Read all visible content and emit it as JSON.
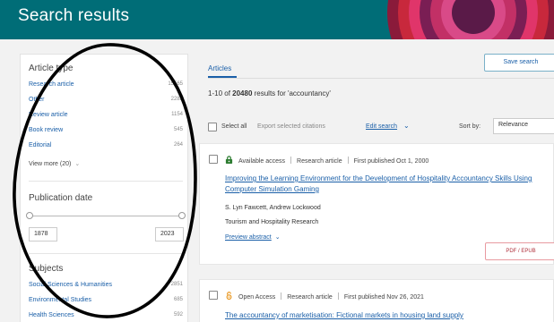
{
  "header": {
    "title": "Search results"
  },
  "sidebar": {
    "article_type": {
      "title": "Article type",
      "items": [
        {
          "label": "Research article",
          "count": "15565"
        },
        {
          "label": "Other",
          "count": "2283"
        },
        {
          "label": "Review article",
          "count": "1154"
        },
        {
          "label": "Book review",
          "count": "545"
        },
        {
          "label": "Editorial",
          "count": "264"
        }
      ],
      "view_more": "View more (20)"
    },
    "publication_date": {
      "title": "Publication date",
      "from": "1878",
      "to": "2023"
    },
    "subjects": {
      "title": "Subjects",
      "items": [
        {
          "label": "Social Sciences & Humanities",
          "count": "2851"
        },
        {
          "label": "Environmental Studies",
          "count": "685"
        },
        {
          "label": "Health Sciences",
          "count": "592"
        }
      ]
    }
  },
  "main": {
    "tab_label": "Articles",
    "save_search": "Save search",
    "results_prefix": "1-10",
    "results_of": " of ",
    "results_total": "20480",
    "results_suffix": " results for 'accountancy'",
    "toolbar": {
      "select_all": "Select all",
      "export": "Export selected citations",
      "edit_search": "Edit search",
      "sort_by": "Sort by:",
      "sort_value": "Relevance"
    },
    "results": [
      {
        "access": "Available access",
        "type": "Research article",
        "published": "First published Oct 1, 2000",
        "title_line1": "Improving the Learning Environment for the Development of Hospitality Accountancy Skills Using",
        "title_line2": "Computer Simulation Gaming",
        "authors": "S. Lyn Fawcett, Andrew Lockwood",
        "journal": "Tourism and Hospitality Research",
        "preview": "Preview abstract",
        "pdf": "PDF / EPUB"
      },
      {
        "access": "Open Access",
        "type": "Research article",
        "published": "First published Nov 26, 2021",
        "title_line1": "The accountancy of marketisation: Fictional markets in housing land supply"
      }
    ]
  },
  "colors": {
    "header_bg": "#006d77",
    "link": "#1a5fa8",
    "available_access": "#2e7d32",
    "open_access": "#e8951c",
    "pdf_button": "#b0303c"
  }
}
